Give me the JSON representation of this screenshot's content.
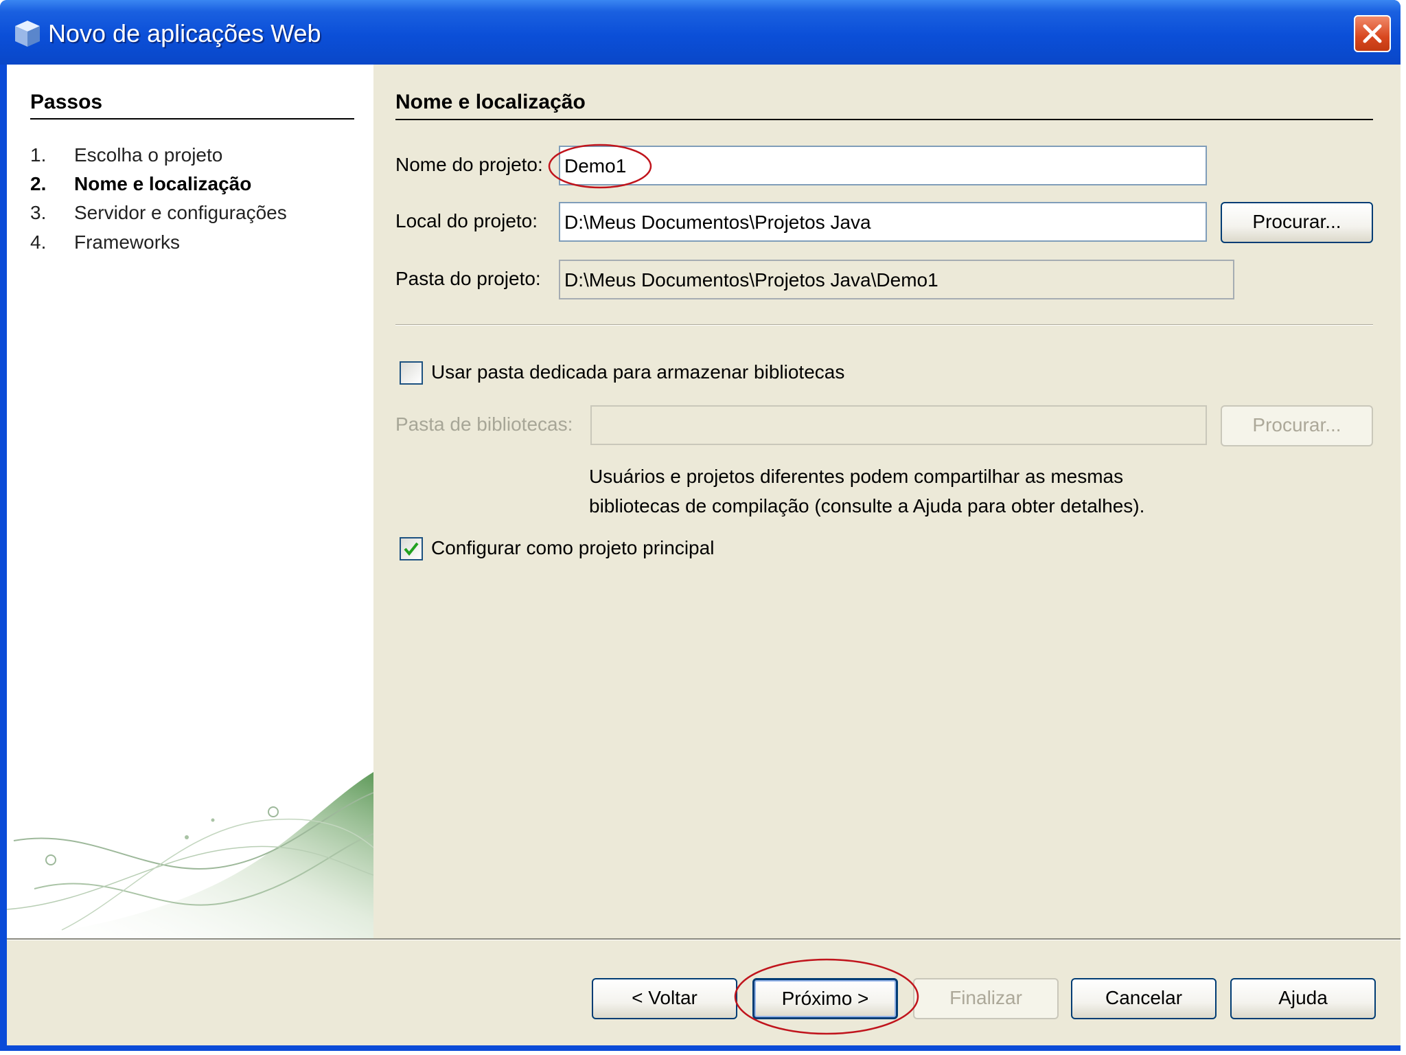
{
  "window": {
    "title": "Novo de aplicações Web",
    "icon": "cube-icon",
    "close_icon": "close-icon"
  },
  "steps": {
    "title": "Passos",
    "items": [
      {
        "number": "1.",
        "label": "Escolha o projeto",
        "current": false
      },
      {
        "number": "2.",
        "label": "Nome e localização",
        "current": true
      },
      {
        "number": "3.",
        "label": "Servidor e configurações",
        "current": false
      },
      {
        "number": "4.",
        "label": "Frameworks",
        "current": false
      }
    ]
  },
  "form": {
    "section_title": "Nome e localização",
    "project_name": {
      "label": "Nome do projeto:",
      "value": "Demo1"
    },
    "project_location": {
      "label": "Local do projeto:",
      "value": "D:\\Meus Documentos\\Projetos Java",
      "browse_label": "Procurar..."
    },
    "project_folder": {
      "label": "Pasta do projeto:",
      "value": "D:\\Meus Documentos\\Projetos Java\\Demo1"
    },
    "dedicated_folder": {
      "label": "Usar pasta dedicada para armazenar bibliotecas",
      "checked": false
    },
    "libraries_folder": {
      "label": "Pasta de bibliotecas:",
      "value": "",
      "browse_label": "Procurar..."
    },
    "help_text": [
      "Usuários e projetos diferentes podem compartilhar as mesmas",
      "bibliotecas de compilação (consulte a Ajuda para obter detalhes)."
    ],
    "main_project": {
      "label": "Configurar como projeto principal",
      "checked": true
    }
  },
  "buttons": {
    "back": "< Voltar",
    "next": "Próximo >",
    "finish": "Finalizar",
    "cancel": "Cancelar",
    "help": "Ajuda"
  },
  "colors": {
    "titlebar": "#0b4fd8",
    "dialog_bg": "#ece9d8",
    "annotation": "#c0141c",
    "check_mark": "#21a121"
  }
}
